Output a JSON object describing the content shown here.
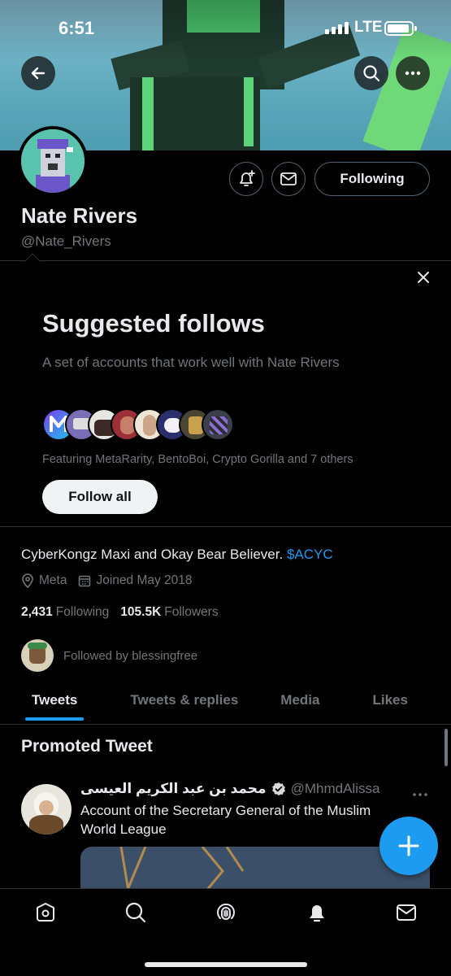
{
  "status_bar": {
    "time": "6:51",
    "network": "LTE"
  },
  "profile": {
    "name": "Nate Rivers",
    "handle": "@Nate_Rivers",
    "following_button": "Following",
    "bio_text": "CyberKongz Maxi and Okay Bear Believer.",
    "bio_cashtag": "$ACYC",
    "location": "Meta",
    "joined": "Joined May 2018",
    "following_count": "2,431",
    "following_label": "Following",
    "followers_count": "105.5K",
    "followers_label": "Followers",
    "followed_by": "Followed by blessingfree"
  },
  "suggested": {
    "title": "Suggested follows",
    "subtitle": "A set of accounts that work well with Nate Rivers",
    "featuring": "Featuring MetaRarity, BentoBoi, Crypto Gorilla and 7 others",
    "follow_all": "Follow all"
  },
  "tabs": [
    {
      "label": "Tweets",
      "active": true
    },
    {
      "label": "Tweets & replies",
      "active": false
    },
    {
      "label": "Media",
      "active": false
    },
    {
      "label": "Likes",
      "active": false
    }
  ],
  "promoted": {
    "header": "Promoted Tweet",
    "author_name": "محمد بن عبد الكريم العيسى",
    "author_handle": "@MhmdAlissa",
    "text": "Account of the Secretary General of the Muslim World League"
  },
  "icons": {
    "back": "back-arrow-icon",
    "search": "search-icon",
    "more": "more-icon",
    "notify": "bell-plus-icon",
    "message": "envelope-icon",
    "nav": [
      "home-icon",
      "search-icon",
      "spaces-icon",
      "notifications-icon",
      "messages-icon"
    ]
  },
  "colors": {
    "accent": "#1d9bf0",
    "background": "#000000",
    "muted": "#71767b"
  }
}
